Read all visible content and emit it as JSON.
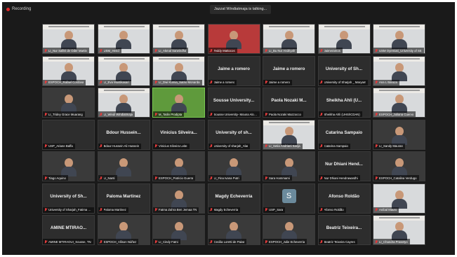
{
  "recording_label": "Recording",
  "talking_label": "Jazzat Windiatmaja is talking...",
  "tiles": [
    {
      "name": "LI_Nur Safitri de Oder Martin",
      "kind": "video",
      "bg": "light",
      "slide": true
    },
    {
      "name": "USM_Hend",
      "kind": "video",
      "bg": "light",
      "slide": true
    },
    {
      "name": "LI_Akmal Sarwindha",
      "kind": "video",
      "bg": "light",
      "slide": true
    },
    {
      "name": "Teddy Mattocos",
      "kind": "video",
      "bg": "red"
    },
    {
      "name": "LI_Bu Nur Andriyah",
      "kind": "video",
      "bg": "light",
      "slide": true
    },
    {
      "name": "Jaimeramos",
      "kind": "video",
      "bg": "light",
      "slide": true
    },
    {
      "name": "USM Oyemiati_University of SE",
      "kind": "video",
      "bg": "light",
      "slide": true
    },
    {
      "name": "ESPOCH_Rafael Cordova",
      "kind": "video",
      "bg": "light",
      "slide": true
    },
    {
      "name": "LI_Eva Mustikasari",
      "kind": "video",
      "bg": "light",
      "slide": true
    },
    {
      "name": "LI_Dwi Kurnia_Satrio Monarda",
      "kind": "video",
      "bg": "light",
      "slide": true
    },
    {
      "name": "Jaime a romero",
      "kind": "name",
      "big": "Jaime a romero"
    },
    {
      "name": "Jaime a romero",
      "kind": "name",
      "big": "Jaime a romero"
    },
    {
      "name": "University of Sharjah _ Maryam",
      "kind": "name",
      "big": "University of Sh..."
    },
    {
      "name": "Ana L Baraza",
      "kind": "video",
      "bg": "light",
      "slide": true
    },
    {
      "name": "LI_Tridey Grace Muarang",
      "kind": "video",
      "bg": "dark"
    },
    {
      "name": "LI_Windi Windiatmaja",
      "kind": "video",
      "bg": "light",
      "slide": true
    },
    {
      "name": "M_Tatlin Prodipta",
      "kind": "video",
      "bg": "green",
      "active": true
    },
    {
      "name": "Sousse University- Mouna Aloudi",
      "kind": "name",
      "big": "Sousse University..."
    },
    {
      "name": "Paola Nozaki Mazzocco",
      "kind": "name",
      "big": "Paola Nozaki M..."
    },
    {
      "name": "Sheikha Ahli (UHS/ICDAN)",
      "kind": "name",
      "big": "Sheikha Ahli (U..."
    },
    {
      "name": "ESPOCH_Juliana Cuervo",
      "kind": "video",
      "bg": "light",
      "slide": true
    },
    {
      "name": "USP_Ariane Baffa",
      "kind": "empty"
    },
    {
      "name": "Bdour Hussein Ali Hussein",
      "kind": "name",
      "big": "Bdour Hussein..."
    },
    {
      "name": "Vinicius Silveira Leite",
      "kind": "name",
      "big": "Vinicius Silveira..."
    },
    {
      "name": "University of sharjah_Alar",
      "kind": "name",
      "big": "University of sh..."
    },
    {
      "name": "LI_Setia Andriani Sanja",
      "kind": "video",
      "bg": "light",
      "slide": true
    },
    {
      "name": "Catarina Sampaio",
      "kind": "name",
      "big": "Catarina Sampaio"
    },
    {
      "name": "LI_Sandy Mauran",
      "kind": "video",
      "bg": "dark"
    },
    {
      "name": "Tiago Aquino",
      "kind": "video",
      "bg": "dark"
    },
    {
      "name": "LI_Nanti",
      "kind": "video",
      "bg": "dark"
    },
    {
      "name": "ESPOCH_Patricio Guerra",
      "kind": "video",
      "bg": "dark"
    },
    {
      "name": "LI_Fina Ivana Putri",
      "kind": "video",
      "bg": "dark"
    },
    {
      "name": "Sara Hammami",
      "kind": "video",
      "bg": "dark"
    },
    {
      "name": "Nur Dhiani Hendrawardhi",
      "kind": "name",
      "big": "Nur Dhiani Hend..."
    },
    {
      "name": "ESPOCH_Catalina Verdugo",
      "kind": "video",
      "bg": "dark"
    },
    {
      "name": "University of Sharjah_Fatima Bra",
      "kind": "name",
      "big": "University of Sh..."
    },
    {
      "name": "Paloma Martinez",
      "kind": "name",
      "big": "Paloma Martinez"
    },
    {
      "name": "Fatma Zahra Ben Jemaa TN",
      "kind": "video",
      "bg": "dark"
    },
    {
      "name": "Magdy Echeverria",
      "kind": "name",
      "big": "Magdy Echeverria"
    },
    {
      "name": "USP_Sara",
      "kind": "avatar",
      "letter": "S"
    },
    {
      "name": "Afonso Roldão",
      "kind": "name",
      "big": "Afonso Roldão"
    },
    {
      "name": "Anibal Mauro",
      "kind": "video",
      "bg": "light"
    },
    {
      "name": "AMINE MTIRAOUI_Sousse, TN",
      "kind": "name",
      "big": "AMINE MTIRAO..."
    },
    {
      "name": "ESPOCH_Allison Núñez",
      "kind": "video",
      "bg": "dark"
    },
    {
      "name": "LI_Cindy Fatni",
      "kind": "video",
      "bg": "dark"
    },
    {
      "name": "Cecilia Loretti de Paiva",
      "kind": "video",
      "bg": "dark"
    },
    {
      "name": "ESPOCH_Julie Echeverria",
      "kind": "video",
      "bg": "dark"
    },
    {
      "name": "Beatriz Teixeira Cayres",
      "kind": "name",
      "big": "Beatriz Teixeira..."
    },
    {
      "name": "LI_Chandra Prasetyo",
      "kind": "video",
      "bg": "light",
      "slide": true
    }
  ]
}
